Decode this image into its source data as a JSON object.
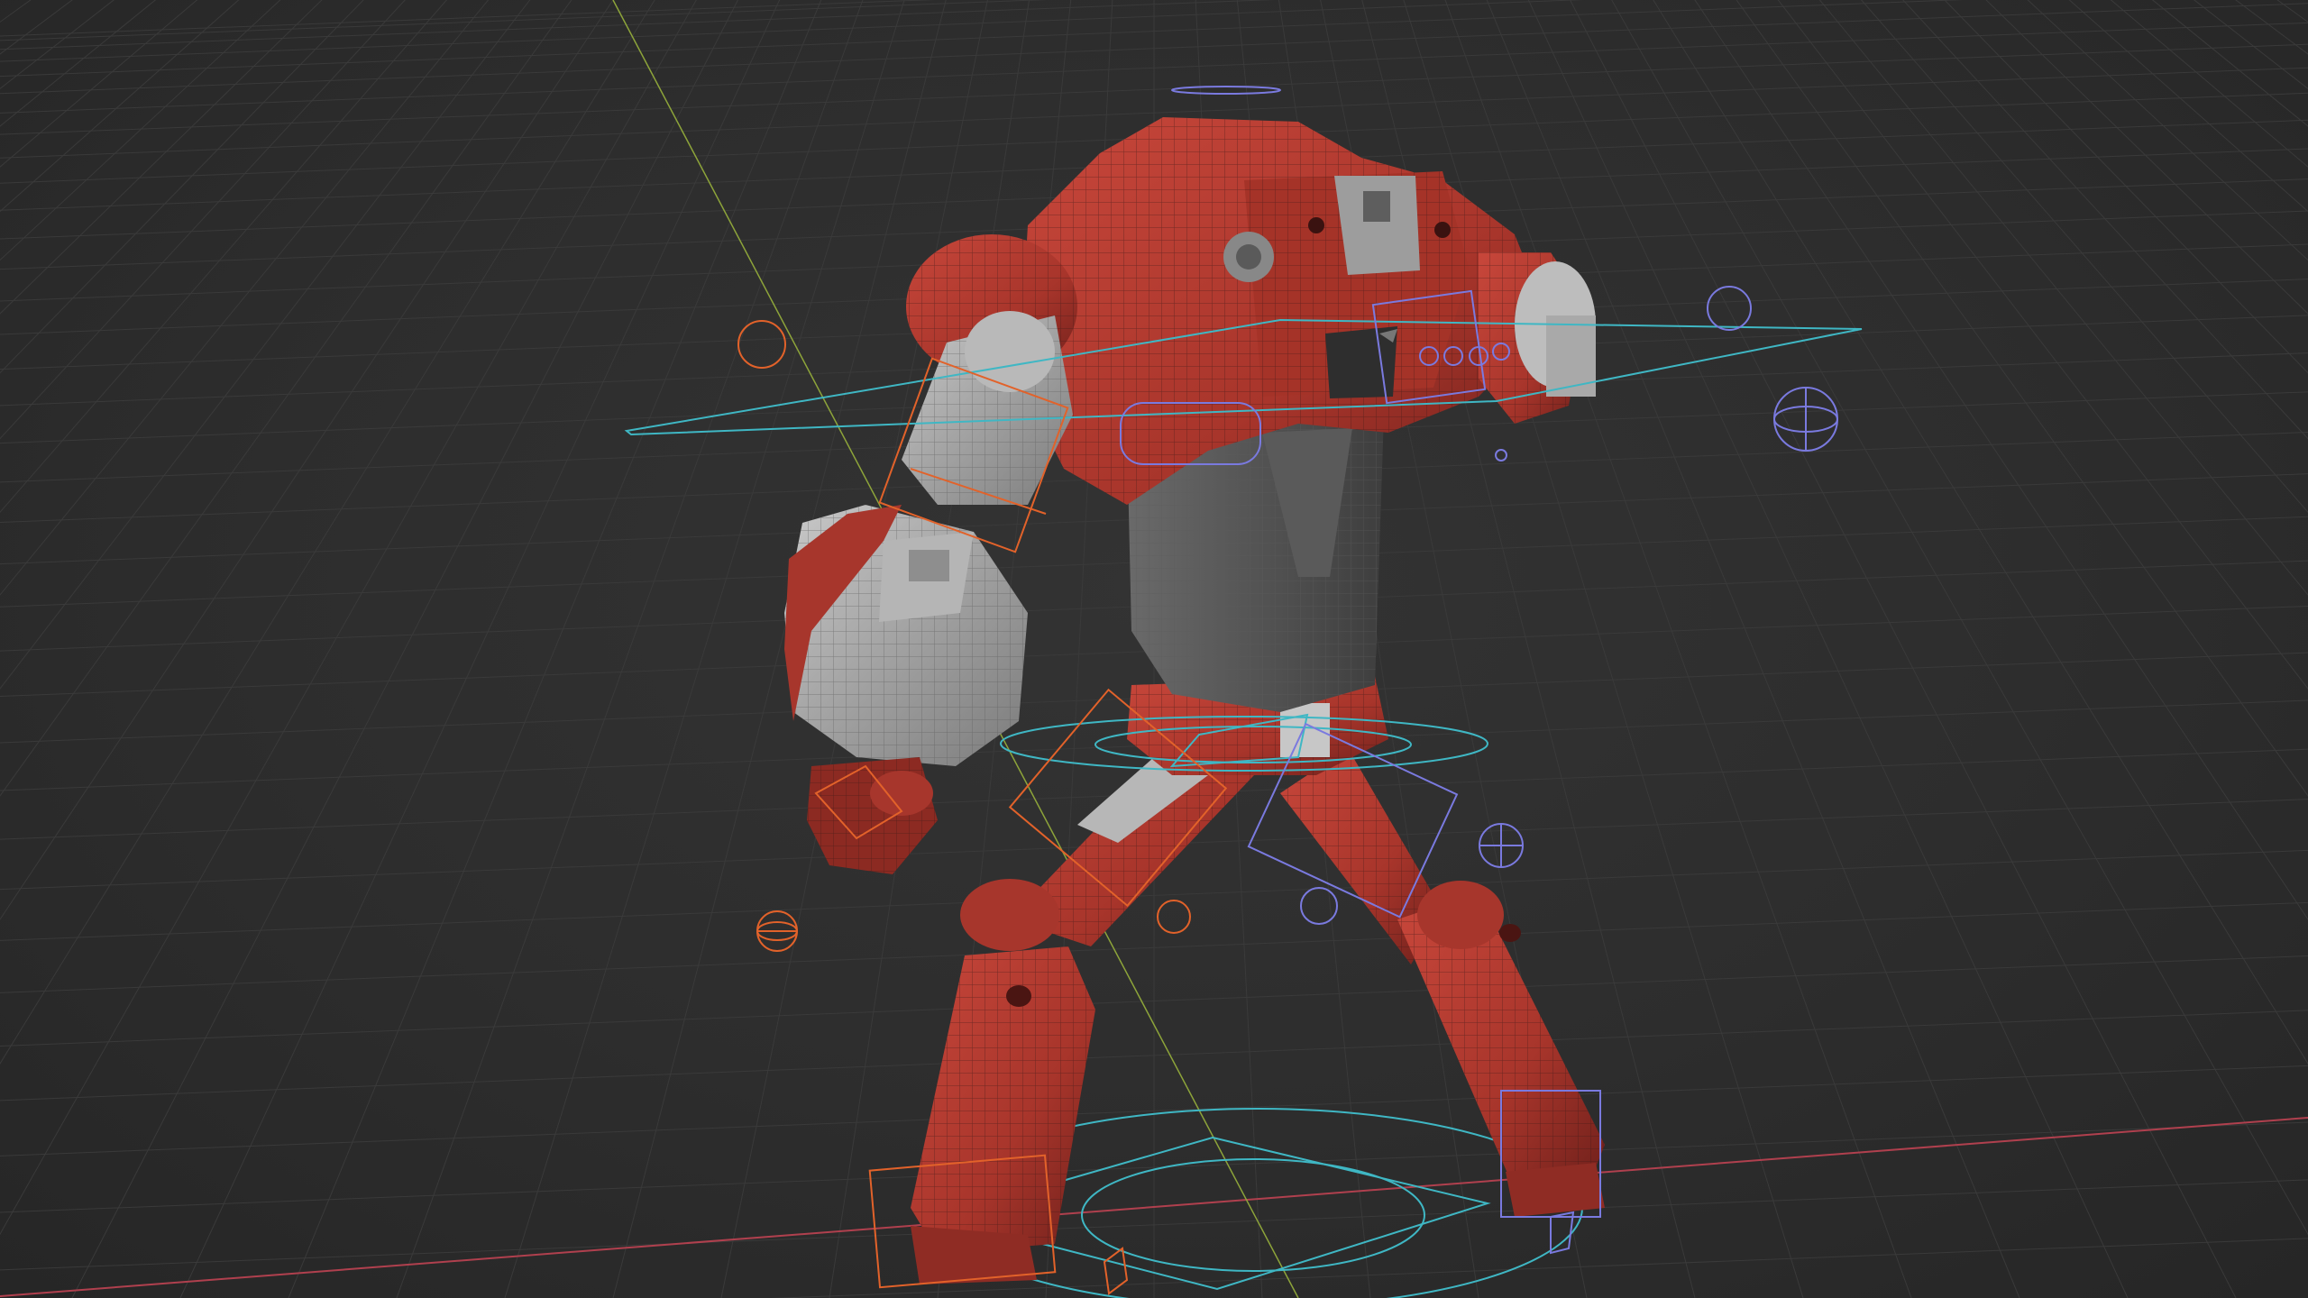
{
  "viewport": {
    "background_color": "#2b2b2b",
    "grid_color": "#3a3a3a",
    "x_axis_color": "#b0404e",
    "y_axis_color": "#8da43a"
  },
  "model": {
    "body_color": "#b23a30",
    "body_dark_color": "#7d2520",
    "metal_color": "#9a9a9a",
    "wire_color": "#3b1a17"
  },
  "rig": {
    "cyan_controls_color": "#3fb7c4",
    "orange_controls_color": "#e2622a",
    "violet_controls_color": "#7a7adf"
  }
}
